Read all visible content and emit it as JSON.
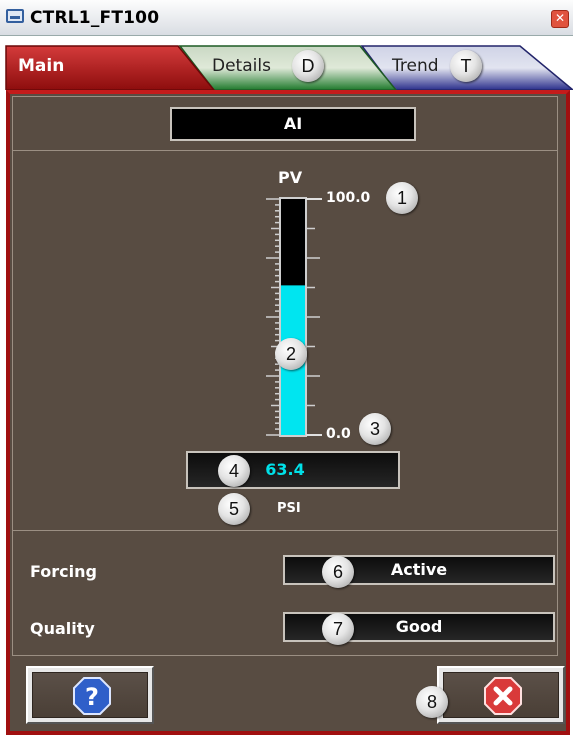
{
  "window": {
    "title": "CTRL1_FT100"
  },
  "tabs": [
    {
      "label": "Main",
      "badge": ""
    },
    {
      "label": "Details",
      "badge": "D"
    },
    {
      "label": "Trend",
      "badge": "T"
    }
  ],
  "header_field": {
    "value": "AI"
  },
  "gauge": {
    "label": "PV",
    "max": "100.0",
    "min": "0.0",
    "fill_fraction": 0.634,
    "value": "63.4",
    "units": "PSI"
  },
  "rows": {
    "forcing": {
      "label": "Forcing",
      "value": "Active"
    },
    "quality": {
      "label": "Quality",
      "value": "Good"
    }
  },
  "callouts": [
    "1",
    "2",
    "3",
    "4",
    "5",
    "6",
    "7",
    "8"
  ],
  "colors": {
    "fill": "#00e5f0",
    "value_text": "#00e0e8",
    "panel": "#584c42",
    "border": "#b01414"
  }
}
